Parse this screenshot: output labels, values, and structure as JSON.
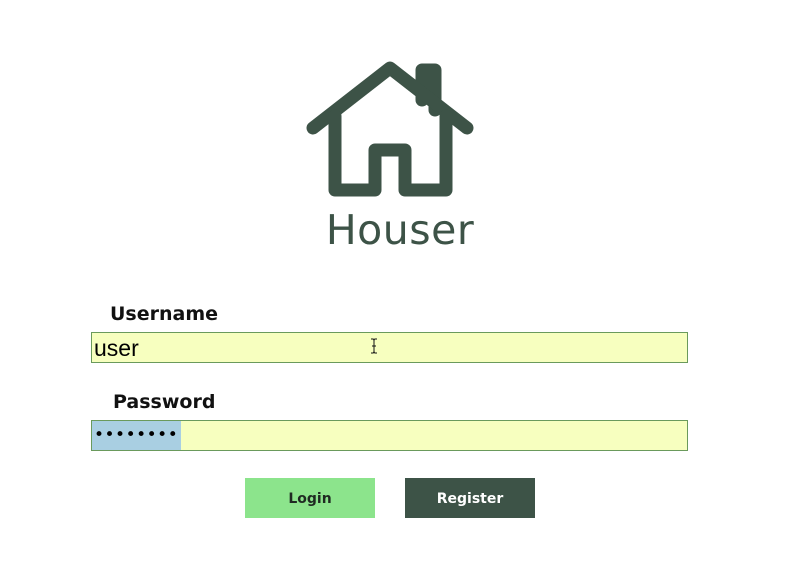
{
  "app": {
    "title": "Houser",
    "logo_icon": "house-icon",
    "brand_color": "#3d5347"
  },
  "form": {
    "username": {
      "label": "Username",
      "value": "user"
    },
    "password": {
      "label": "Password",
      "masked_value": "••••••••",
      "selected": true
    },
    "input_background": "#f7ffbf"
  },
  "buttons": {
    "login_label": "Login",
    "login_color": "#8ce48c",
    "register_label": "Register",
    "register_color": "#3d5347"
  },
  "cursor": {
    "icon": "text-cursor-icon"
  }
}
